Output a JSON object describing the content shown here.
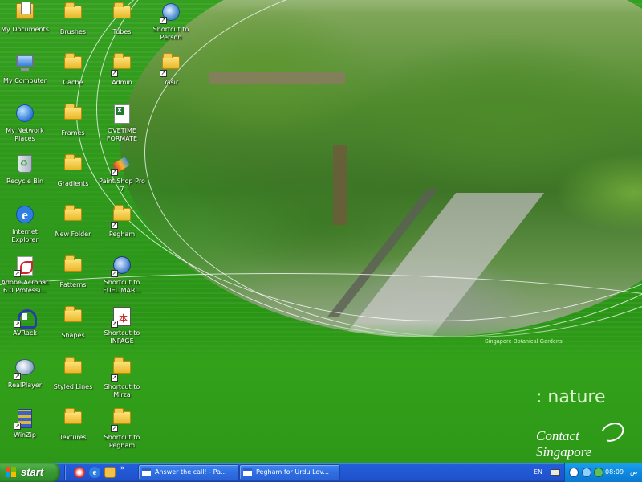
{
  "desktop": {
    "icons": [
      {
        "label": "My Documents"
      },
      {
        "label": "Brushes"
      },
      {
        "label": "Tubes"
      },
      {
        "label": "Shortcut to Person"
      },
      {
        "label": "My Computer"
      },
      {
        "label": "Cache"
      },
      {
        "label": "Admin"
      },
      {
        "label": "Yasir"
      },
      {
        "label": "My Network Places"
      },
      {
        "label": "Frames"
      },
      {
        "label": "OVETIME FORMATE"
      },
      {
        "label": "Recycle Bin"
      },
      {
        "label": "Gradients"
      },
      {
        "label": "Paint Shop Pro 7"
      },
      {
        "label": "Internet Explorer"
      },
      {
        "label": "New Folder"
      },
      {
        "label": "Pegham"
      },
      {
        "label": "Adobe Acrobat 6.0 Professi..."
      },
      {
        "label": "Patterns"
      },
      {
        "label": "Shortcut to FUEL MAR..."
      },
      {
        "label": "AVRack"
      },
      {
        "label": "Shapes"
      },
      {
        "label": "Shortcut to INPAGE"
      },
      {
        "label": "RealPlayer"
      },
      {
        "label": "Styled Lines"
      },
      {
        "label": "Shortcut to Mirza"
      },
      {
        "label": "WinZip"
      },
      {
        "label": "Textures"
      },
      {
        "label": "Shortcut to Pegham"
      }
    ]
  },
  "wallpaper": {
    "caption": "Singapore Botanical Gardens",
    "slogan": ": nature",
    "brand_line1": "Contact",
    "brand_line2": "Singapore"
  },
  "taskbar": {
    "start_label": "start",
    "quick_launch_more": "»",
    "tasks": [
      {
        "label": "Answer the call! - Pa..."
      },
      {
        "label": "Pegham for Urdu Lov..."
      }
    ],
    "language": "EN",
    "clock": "08:09",
    "tray_text": "ص"
  },
  "colors": {
    "taskbar_blue": "#245edb",
    "start_green": "#3a9a33",
    "desktop_green": "#2e9a1c"
  }
}
